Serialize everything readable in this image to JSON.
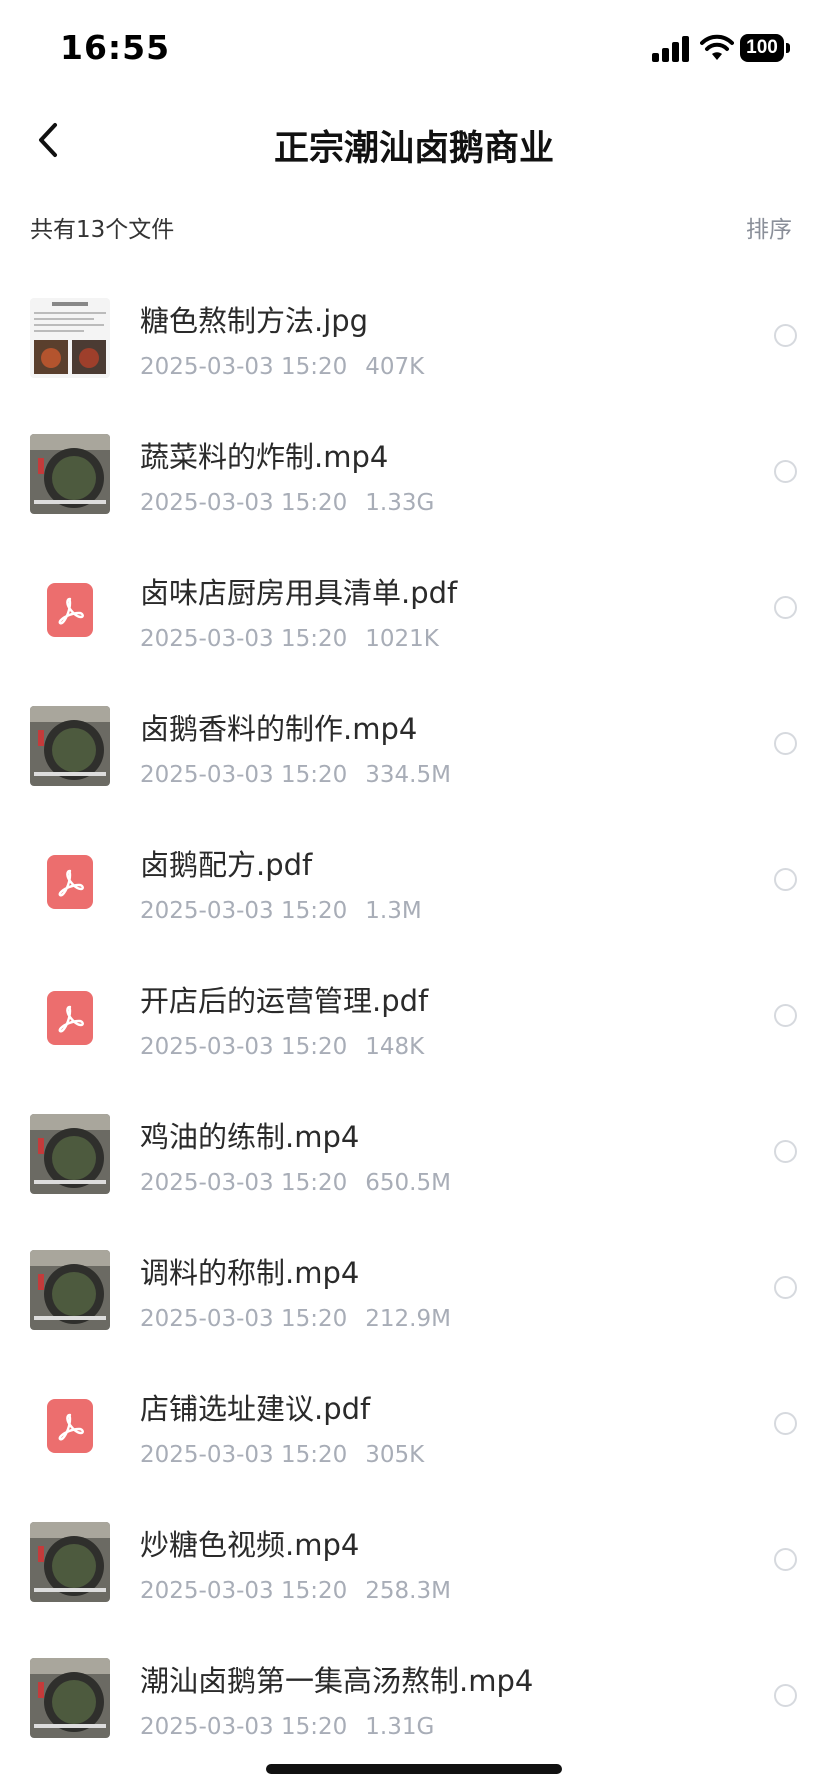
{
  "status_bar": {
    "time": "16:55",
    "battery": "100"
  },
  "nav": {
    "title": "正宗潮汕卤鹅商业",
    "back_icon": "chevron-left-icon"
  },
  "header": {
    "file_count": "共有13个文件",
    "sort_label": "排序"
  },
  "files": [
    {
      "name": "糖色熬制方法.jpg",
      "date": "2025-03-03 15:20",
      "size": "407K",
      "type": "image"
    },
    {
      "name": "蔬菜料的炸制.mp4",
      "date": "2025-03-03 15:20",
      "size": "1.33G",
      "type": "video"
    },
    {
      "name": "卤味店厨房用具清单.pdf",
      "date": "2025-03-03 15:20",
      "size": "1021K",
      "type": "pdf"
    },
    {
      "name": "卤鹅香料的制作.mp4",
      "date": "2025-03-03 15:20",
      "size": "334.5M",
      "type": "video"
    },
    {
      "name": "卤鹅配方.pdf",
      "date": "2025-03-03 15:20",
      "size": "1.3M",
      "type": "pdf"
    },
    {
      "name": "开店后的运营管理.pdf",
      "date": "2025-03-03 15:20",
      "size": "148K",
      "type": "pdf"
    },
    {
      "name": "鸡油的练制.mp4",
      "date": "2025-03-03 15:20",
      "size": "650.5M",
      "type": "video"
    },
    {
      "name": "调料的称制.mp4",
      "date": "2025-03-03 15:20",
      "size": "212.9M",
      "type": "video"
    },
    {
      "name": "店铺选址建议.pdf",
      "date": "2025-03-03 15:20",
      "size": "305K",
      "type": "pdf"
    },
    {
      "name": "炒糖色视频.mp4",
      "date": "2025-03-03 15:20",
      "size": "258.3M",
      "type": "video"
    },
    {
      "name": "潮汕卤鹅第一集高汤熬制.mp4",
      "date": "2025-03-03 15:20",
      "size": "1.31G",
      "type": "video"
    }
  ],
  "colors": {
    "pdf_icon": "#ec6e6e",
    "meta_text": "#a8adb7",
    "sort_text": "#8a8f99"
  }
}
